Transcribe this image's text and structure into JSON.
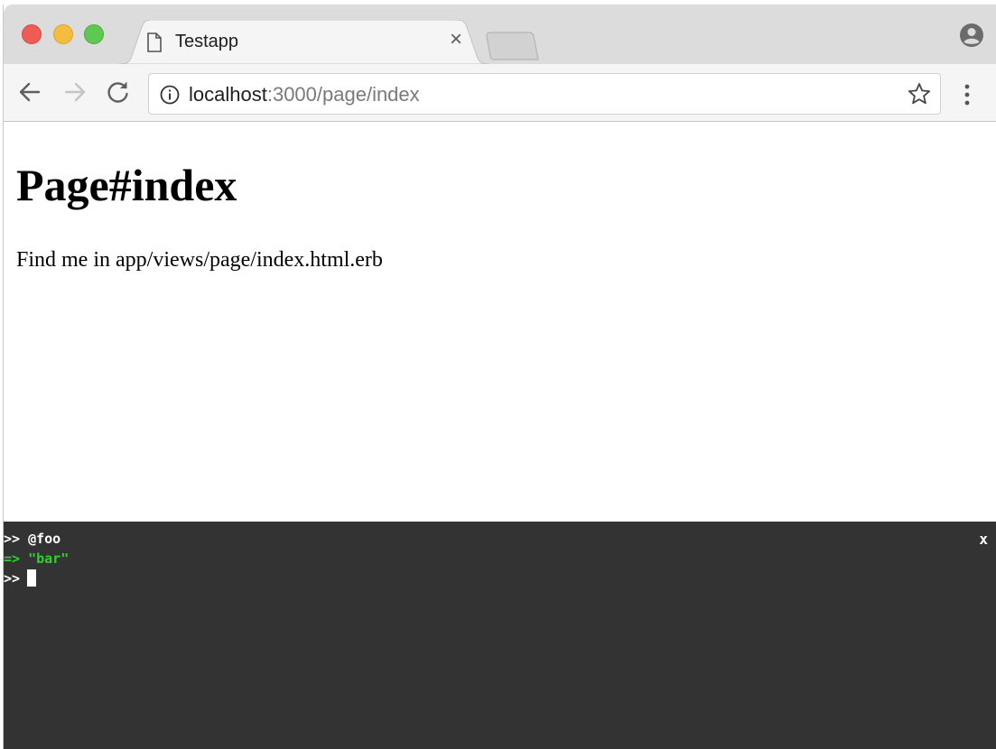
{
  "browser": {
    "tab": {
      "title": "Testapp",
      "close_symbol": "×",
      "icon": "page-icon"
    },
    "new_tab_icon": "new-tab-icon",
    "profile_icon": "profile-icon",
    "toolbar": {
      "back_icon": "back-arrow-icon",
      "forward_icon": "forward-arrow-icon",
      "reload_icon": "reload-icon",
      "info_icon": "info-icon",
      "url_host": "localhost",
      "url_path": ":3000/page/index",
      "bookmark_icon": "star-icon",
      "menu_icon": "kebab-menu-icon"
    }
  },
  "page": {
    "heading": "Page#index",
    "paragraph": "Find me in app/views/page/index.html.erb"
  },
  "console": {
    "lines": [
      {
        "prompt": ">>",
        "text": "@foo"
      },
      {
        "prompt": "=>",
        "text": "\"bar\""
      },
      {
        "prompt": ">>",
        "text": ""
      }
    ],
    "close_label": "x",
    "colors": {
      "background": "#333333",
      "result": "#2fd02f",
      "text": "#ffffff"
    }
  }
}
